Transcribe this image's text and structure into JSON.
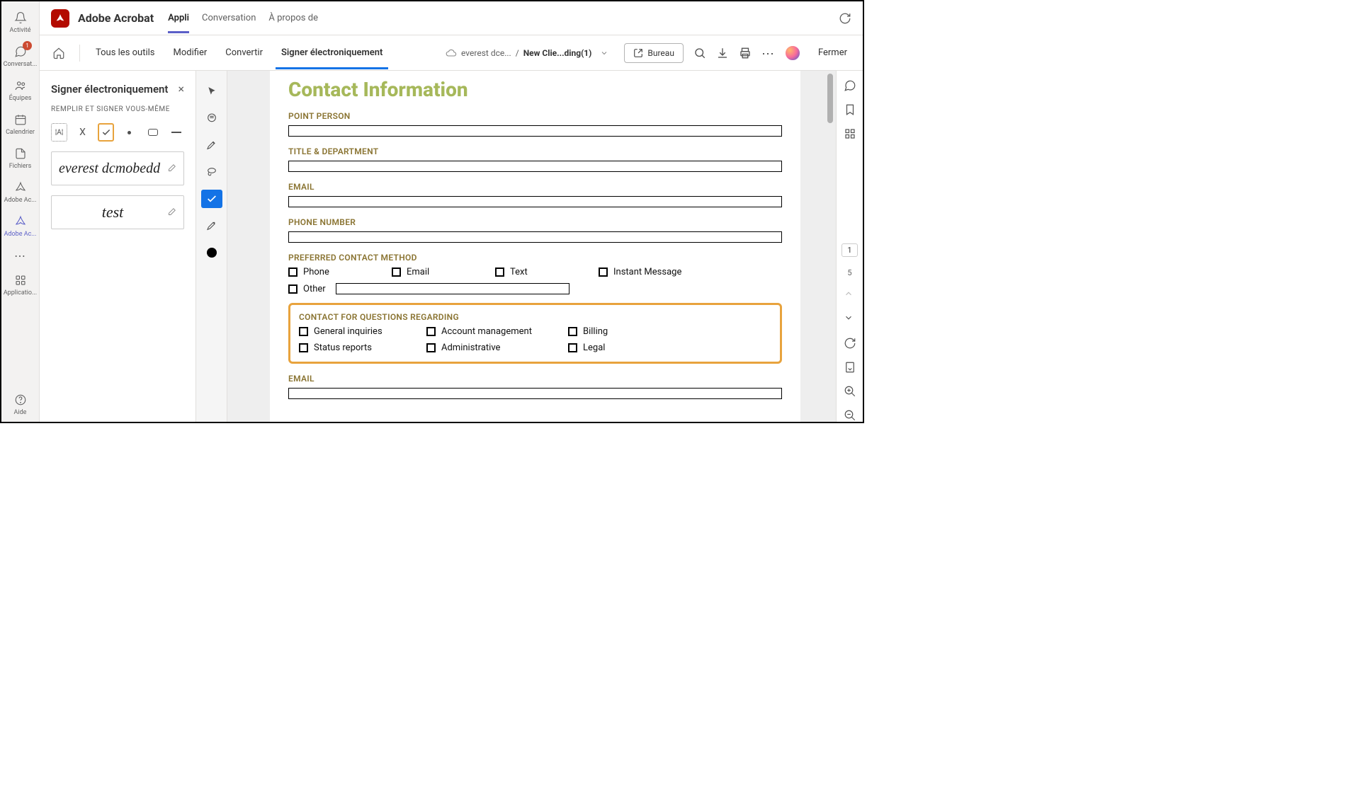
{
  "rail": {
    "items": [
      {
        "label": "Activité"
      },
      {
        "label": "Conversat...",
        "badge": "1"
      },
      {
        "label": "Équipes"
      },
      {
        "label": "Calendrier"
      },
      {
        "label": "Fichiers"
      },
      {
        "label": "Adobe Ac..."
      },
      {
        "label": "Adobe Ac..."
      }
    ],
    "apps_label": "Applicatio...",
    "help_label": "Aide"
  },
  "header": {
    "app_title": "Adobe Acrobat",
    "tabs": [
      {
        "label": "Appli",
        "active": true
      },
      {
        "label": "Conversation"
      },
      {
        "label": "À propos de"
      }
    ]
  },
  "toolbar": {
    "tabs": [
      {
        "label": "Tous les outils"
      },
      {
        "label": "Modifier"
      },
      {
        "label": "Convertir"
      },
      {
        "label": "Signer électroniquement",
        "active": true
      }
    ],
    "cloud_name": "everest dce...",
    "doc_name": "New Clie...ding(1)",
    "bureau_label": "Bureau",
    "close_label": "Fermer"
  },
  "panel": {
    "title": "Signer électroniquement",
    "subtitle": "REMPLIR ET SIGNER VOUS-MÊME",
    "signature1": "everest dcmobedd",
    "signature2": "test"
  },
  "doc": {
    "title": "Contact Information",
    "labels": {
      "point_person": "POINT PERSON",
      "title_dept": "TITLE & DEPARTMENT",
      "email": "EMAIL",
      "phone": "PHONE NUMBER",
      "pref_method": "PREFERRED CONTACT METHOD",
      "contact_for": "CONTACT FOR QUESTIONS REGARDING",
      "email2": "EMAIL"
    },
    "methods": {
      "phone": "Phone",
      "email": "Email",
      "text": "Text",
      "instant": "Instant Message",
      "other": "Other"
    },
    "questions": {
      "general": "General inquiries",
      "account": "Account management",
      "billing": "Billing",
      "status": "Status reports",
      "admin": "Administrative",
      "legal": "Legal"
    }
  },
  "pages": {
    "current": "1",
    "total": "5"
  }
}
